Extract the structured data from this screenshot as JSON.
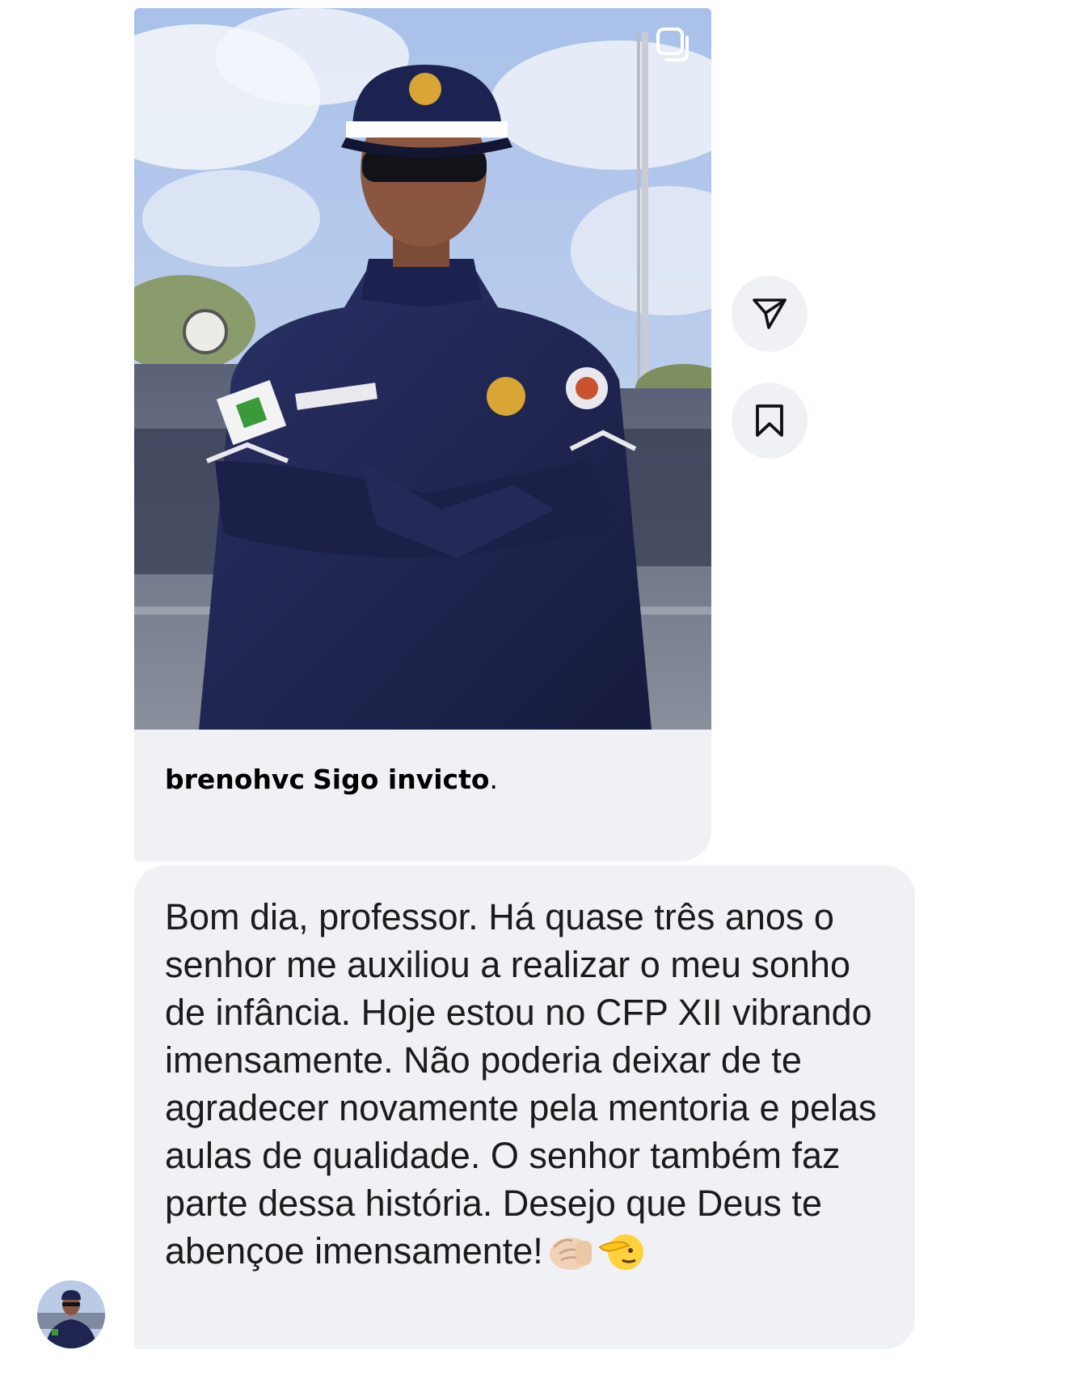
{
  "post": {
    "image_alt": "Policial militar de uniforme azul marinho com braços cruzados",
    "multi_icon": "multiple-photos-icon",
    "caption_username": "brenohvc",
    "caption_bold": "Sigo invicto",
    "caption_tail": "."
  },
  "actions": {
    "share_icon": "send-icon",
    "save_icon": "bookmark-icon"
  },
  "message": {
    "text": "Bom dia, professor. Há quase três anos o senhor me auxiliou a realizar o meu sonho de infância. Hoje estou no CFP XII vibrando imensamente. Não poderia deixar de te agradecer novamente pela mentoria e pelas aulas de qualidade. O senhor também faz parte dessa história. Desejo que Deus te abençoe imensamente!",
    "emoji_1": "fist-bump-emoji",
    "emoji_2": "saluting-face-emoji"
  },
  "avatar": {
    "icon": "profile-avatar"
  },
  "colors": {
    "bubble": "#eff1f5",
    "text": "#1b1b1b",
    "uniform": "#1f2550"
  }
}
